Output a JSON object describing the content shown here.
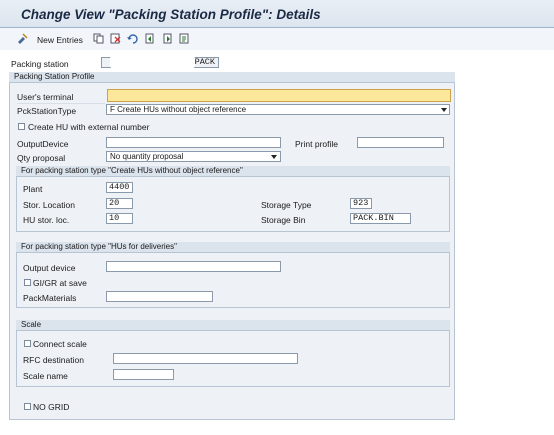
{
  "title": "Change View \"Packing Station Profile\": Details",
  "toolbar": {
    "new_entries_label": "New Entries"
  },
  "header": {
    "packing_station_label": "Packing station",
    "packing_station_value": "PACK"
  },
  "profile_frame": {
    "title": "Packing Station Profile",
    "users_terminal_label": "User's terminal",
    "users_terminal_value": "",
    "pck_station_type_label": "PckStationType",
    "pck_station_type_value": "F Create HUs without object reference",
    "create_hu_ext_label": "Create HU with external number",
    "output_device_label": "OutputDevice",
    "output_device_value": "",
    "print_profile_label": "Print profile",
    "print_profile_value": "",
    "qty_proposal_label": "Qty proposal",
    "qty_proposal_value": "No quantity proposal"
  },
  "type_create_hu_frame": {
    "title": "For packing station type \"Create HUs without object reference\"",
    "plant_label": "Plant",
    "plant_value": "4400",
    "stor_location_label": "Stor. Location",
    "stor_location_value": "20",
    "hu_stor_loc_label": "HU stor. loc.",
    "hu_stor_loc_value": "10",
    "storage_type_label": "Storage Type",
    "storage_type_value": "923",
    "storage_bin_label": "Storage Bin",
    "storage_bin_value": "PACK.BIN"
  },
  "type_deliveries_frame": {
    "title": "For packing station type \"HUs for deliveries\"",
    "output_device_label": "Output device",
    "output_device_value": "",
    "gigr_label": "GI/GR at save",
    "pack_materials_label": "PackMaterials",
    "pack_materials_value": ""
  },
  "scale_frame": {
    "title": "Scale",
    "connect_scale_label": "Connect scale",
    "rfc_destination_label": "RFC destination",
    "rfc_destination_value": "",
    "scale_name_label": "Scale name",
    "scale_name_value": ""
  },
  "no_grid_label": "NO GRID",
  "colors": {
    "required_field": "#fde79a",
    "frame_bg": "#eef2f7",
    "title_text": "#1a2a44"
  }
}
